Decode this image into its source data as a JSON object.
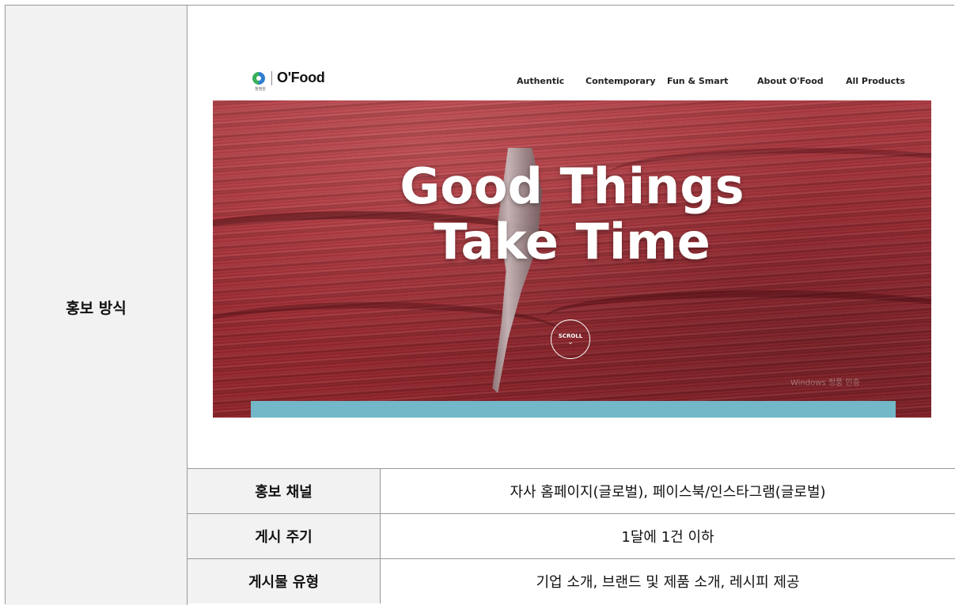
{
  "section_label": "홍보 방식",
  "website": {
    "logo": {
      "text": "O'Food",
      "sub_text": "청정원",
      "icon": "ofood-logo-icon"
    },
    "nav": [
      "Authentic",
      "Contemporary",
      "Fun & Smart",
      "About O'Food",
      "All Products"
    ],
    "hero": {
      "title_line1": "Good Things",
      "title_line2": "Take Time",
      "scroll_label": "SCROLL",
      "scroll_icon": "chevron-down-icon",
      "watermark": "Windows 정품 인증"
    },
    "colors": {
      "hero_red": "#a02b33",
      "bar_teal": "#72b8c8"
    }
  },
  "rows": [
    {
      "label": "홍보 채널",
      "value": "자사 홈페이지(글로벌), 페이스북/인스타그램(글로벌)"
    },
    {
      "label": "게시 주기",
      "value": "1달에 1건 이하"
    },
    {
      "label": "게시물 유형",
      "value": "기업 소개, 브랜드 및 제품 소개, 레시피 제공"
    }
  ]
}
